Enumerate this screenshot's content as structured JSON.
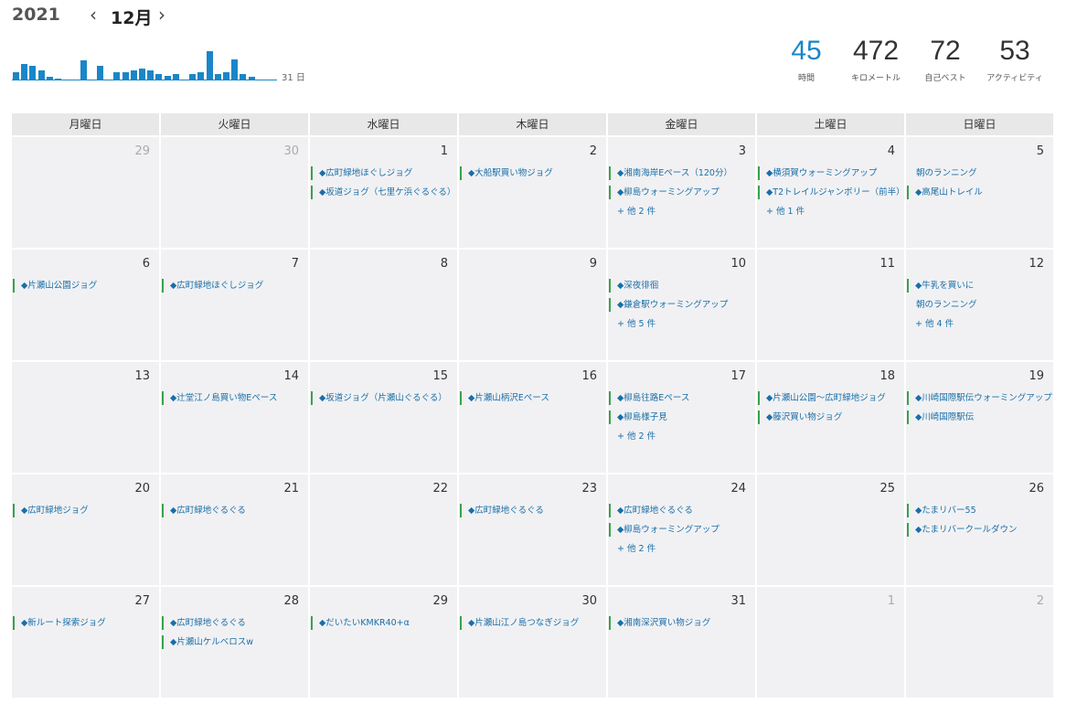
{
  "header": {
    "year": "2021",
    "prev_icon": "chevron-left-icon",
    "month": "12月",
    "next_icon": "chevron-right-icon",
    "hist_label": "31 日",
    "hist_values": [
      0.25,
      0.5,
      0.45,
      0.3,
      0.1,
      0.05,
      0,
      0,
      0.6,
      0,
      0.45,
      0,
      0.25,
      0.25,
      0.3,
      0.35,
      0.3,
      0.2,
      0.15,
      0.2,
      0,
      0.2,
      0.25,
      0.9,
      0.2,
      0.25,
      0.65,
      0.2,
      0.1
    ],
    "accent_color": "#1a86c8"
  },
  "stats": [
    {
      "value": "45",
      "label": "時間"
    },
    {
      "value": "472",
      "label": "キロメートル"
    },
    {
      "value": "72",
      "label": "自己ベスト"
    },
    {
      "value": "53",
      "label": "アクティビティ"
    }
  ],
  "weekdays": [
    "月曜日",
    "火曜日",
    "水曜日",
    "木曜日",
    "金曜日",
    "土曜日",
    "日曜日"
  ],
  "weeks": [
    [
      {
        "date": "29",
        "muted": true,
        "events": []
      },
      {
        "date": "30",
        "muted": true,
        "events": []
      },
      {
        "date": "1",
        "events": [
          {
            "t": "◆広町緑地ほぐしジョグ"
          },
          {
            "t": "◆坂道ジョグ（七里ケ浜ぐるぐる）"
          }
        ]
      },
      {
        "date": "2",
        "events": [
          {
            "t": "◆大船駅買い物ジョグ"
          }
        ]
      },
      {
        "date": "3",
        "events": [
          {
            "t": "◆湘南海岸Eペース（120分）"
          },
          {
            "t": "◆柳島ウォーミングアップ"
          }
        ],
        "more": "+ 他 2 件"
      },
      {
        "date": "4",
        "events": [
          {
            "t": "◆横須賀ウォーミングアップ"
          },
          {
            "t": "◆T2トレイルジャンボリー（前半）"
          }
        ],
        "more": "+ 他 1 件"
      },
      {
        "date": "5",
        "events": [
          {
            "t": "朝のランニング",
            "plain": true
          },
          {
            "t": "◆高尾山トレイル"
          }
        ]
      }
    ],
    [
      {
        "date": "6",
        "events": [
          {
            "t": "◆片瀬山公園ジョグ"
          }
        ]
      },
      {
        "date": "7",
        "events": [
          {
            "t": "◆広町緑地ほぐしジョグ"
          }
        ]
      },
      {
        "date": "8",
        "events": []
      },
      {
        "date": "9",
        "events": []
      },
      {
        "date": "10",
        "events": [
          {
            "t": "◆深夜徘徊"
          },
          {
            "t": "◆鎌倉駅ウォーミングアップ"
          }
        ],
        "more": "+ 他 5 件"
      },
      {
        "date": "11",
        "events": []
      },
      {
        "date": "12",
        "events": [
          {
            "t": "◆牛乳を買いに"
          },
          {
            "t": "朝のランニング",
            "plain": true
          }
        ],
        "more": "+ 他 4 件"
      }
    ],
    [
      {
        "date": "13",
        "events": []
      },
      {
        "date": "14",
        "events": [
          {
            "t": "◆辻堂江ノ島買い物Eペース"
          }
        ]
      },
      {
        "date": "15",
        "events": [
          {
            "t": "◆坂道ジョグ（片瀬山ぐるぐる）"
          }
        ]
      },
      {
        "date": "16",
        "events": [
          {
            "t": "◆片瀬山柄沢Eペース"
          }
        ]
      },
      {
        "date": "17",
        "events": [
          {
            "t": "◆柳島往路Eペース"
          },
          {
            "t": "◆柳島様子見"
          }
        ],
        "more": "+ 他 2 件"
      },
      {
        "date": "18",
        "events": [
          {
            "t": "◆片瀬山公園〜広町緑地ジョグ"
          },
          {
            "t": "◆藤沢買い物ジョグ"
          }
        ]
      },
      {
        "date": "19",
        "events": [
          {
            "t": "◆川崎国際駅伝ウォーミングアップ"
          },
          {
            "t": "◆川崎国際駅伝"
          }
        ]
      }
    ],
    [
      {
        "date": "20",
        "events": [
          {
            "t": "◆広町緑地ジョグ"
          }
        ]
      },
      {
        "date": "21",
        "events": [
          {
            "t": "◆広町緑地ぐるぐる"
          }
        ]
      },
      {
        "date": "22",
        "events": []
      },
      {
        "date": "23",
        "events": [
          {
            "t": "◆広町緑地ぐるぐる"
          }
        ]
      },
      {
        "date": "24",
        "events": [
          {
            "t": "◆広町緑地ぐるぐる"
          },
          {
            "t": "◆柳島ウォーミングアップ"
          }
        ],
        "more": "+ 他 2 件"
      },
      {
        "date": "25",
        "events": []
      },
      {
        "date": "26",
        "events": [
          {
            "t": "◆たまリバー55"
          },
          {
            "t": "◆たまリバークールダウン"
          }
        ]
      }
    ],
    [
      {
        "date": "27",
        "events": [
          {
            "t": "◆新ルート探索ジョグ"
          }
        ]
      },
      {
        "date": "28",
        "events": [
          {
            "t": "◆広町緑地ぐるぐる"
          },
          {
            "t": "◆片瀬山ケルベロスw"
          }
        ]
      },
      {
        "date": "29",
        "events": [
          {
            "t": "◆だいたいKMKR40+α"
          }
        ]
      },
      {
        "date": "30",
        "events": [
          {
            "t": "◆片瀬山江ノ島つなぎジョグ"
          }
        ]
      },
      {
        "date": "31",
        "events": [
          {
            "t": "◆湘南深沢買い物ジョグ"
          }
        ]
      },
      {
        "date": "1",
        "muted": true,
        "events": []
      },
      {
        "date": "2",
        "muted": true,
        "events": []
      }
    ]
  ]
}
